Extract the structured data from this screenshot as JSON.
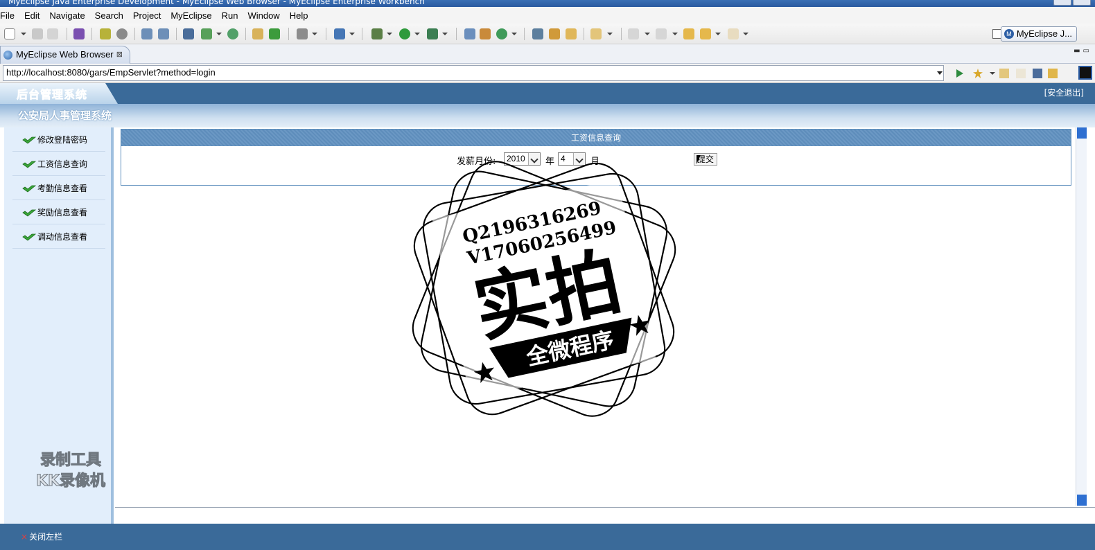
{
  "window": {
    "title": "MyEclipse Java Enterprise Development - MyEclipse Web Browser - MyEclipse Enterprise Workbench"
  },
  "menu": [
    "File",
    "Edit",
    "Navigate",
    "Search",
    "Project",
    "MyEclipse",
    "Run",
    "Window",
    "Help"
  ],
  "toolbar": {
    "perspective_label": "MyEclipse J..."
  },
  "editor_tab": {
    "label": "MyEclipse Web Browser",
    "close": "⊠"
  },
  "browser": {
    "url": "http://localhost:8080/gars/EmpServlet?method=login"
  },
  "app": {
    "logo": "后台管理系统",
    "logout": "[安全退出]",
    "system_title": "公安局人事管理系统",
    "sidebar": [
      {
        "label": "修改登陆密码"
      },
      {
        "label": "工资信息查询"
      },
      {
        "label": "考勤信息查看"
      },
      {
        "label": "奖励信息查看"
      },
      {
        "label": "调动信息查看"
      }
    ],
    "panel": {
      "title": "工资信息查询",
      "month_label": "发薪月份:",
      "year_value": "2010",
      "year_unit": "年",
      "month_value": "4",
      "month_unit": "月",
      "submit": "提交"
    },
    "footer": {
      "close_sidebar": "关闭左栏"
    }
  },
  "watermarks": {
    "recorder_line1": "录制工具",
    "recorder_line2": "KK录像机",
    "stamp_line1": "Q2196316269",
    "stamp_line2": "V17060256499",
    "stamp_main": "实拍",
    "stamp_banner": "全微程序"
  },
  "colors": {
    "header_blue": "#3a6a99",
    "sidebar_bg": "#e2eefb",
    "panel_head": "#5e8dbb"
  }
}
